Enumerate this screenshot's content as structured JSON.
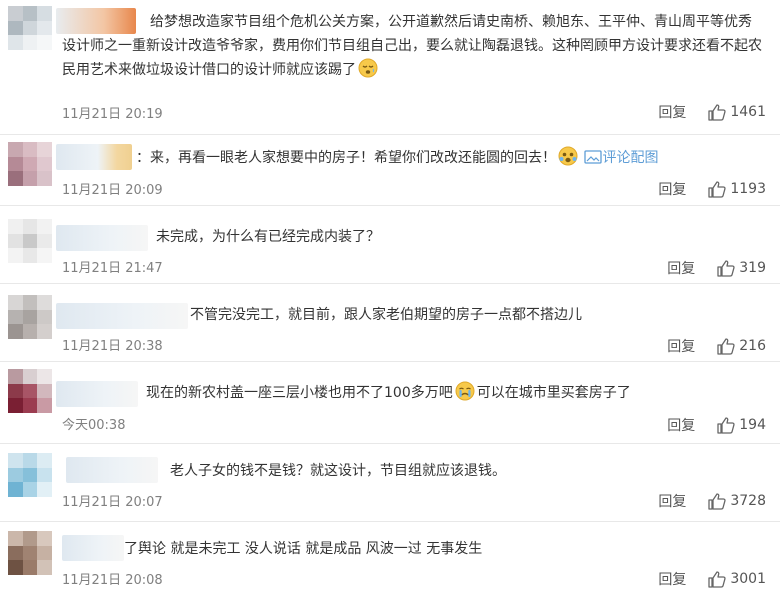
{
  "comments": [
    {
      "text": "给梦想改造家节目组个危机公关方案，公开道歉然后请史南桥、赖旭东、王平仲、青山周平等优秀设计师之一重新设计改造爷爷家，费用你们节目组自己出，要么就让陶磊退钱。这种罔顾甲方设计要求还看不起农民用艺术来做垃圾设计借口的设计师就应该踢了",
      "emoji": "sleepy-emoji",
      "time": "11月21日 20:19",
      "reply": "回复",
      "likes": "1461"
    },
    {
      "text": "：来，再看一眼老人家想要中的房子！希望你们改改还能圆的回去！",
      "emoji": "shocked-emoji",
      "pic_label": "评论配图",
      "time": "11月21日 20:09",
      "reply": "回复",
      "likes": "1193"
    },
    {
      "text": "未完成，为什么有已经完成内装了？",
      "time": "11月21日 21:47",
      "reply": "回复",
      "likes": "319"
    },
    {
      "text": "不管完没完工，就目前，跟人家老伯期望的房子一点都不搭边儿",
      "time": "11月21日 20:38",
      "reply": "回复",
      "likes": "216"
    },
    {
      "text": "现在的新农村盖一座三层小楼也用不了100多万吧",
      "emoji": "crying-emoji",
      "text_after": "可以在城市里买套房子了",
      "time": "今天00:38",
      "reply": "回复",
      "likes": "194"
    },
    {
      "text": "老人子女的钱不是钱？就这设计，节目组就应该退钱。",
      "time": "11月21日 20:07",
      "reply": "回复",
      "likes": "3728"
    },
    {
      "text": "了舆论 就是未完工 没人说话 就是成品 风波一过 无事发生",
      "time": "11月21日 20:08",
      "reply": "回复",
      "likes": "3001"
    }
  ],
  "colors": {
    "link": "#5e9dd6",
    "muted": "#808080",
    "divider": "#e8e8e8"
  }
}
